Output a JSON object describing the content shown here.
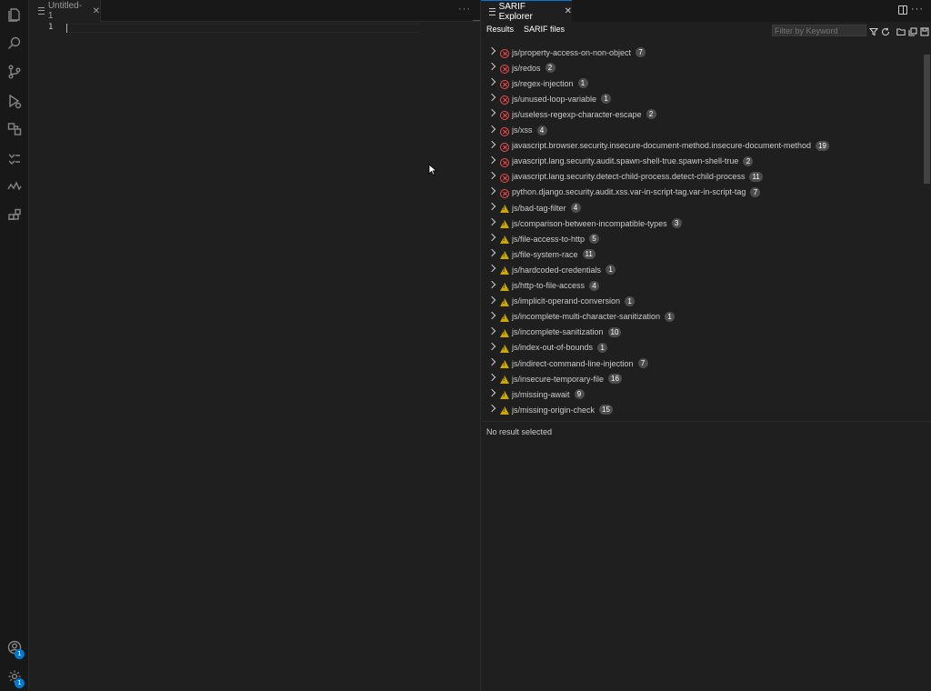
{
  "activity_bar": {
    "accounts_badge": "1",
    "settings_badge": "1"
  },
  "editor": {
    "tab_label": "Untitled-1",
    "line_number": "1"
  },
  "sarif": {
    "tab_label": "SARIF Explorer",
    "results_tab": "Results",
    "files_tab": "SARIF files",
    "filter_placeholder": "Filter by Keyword",
    "no_result_text": "No result selected",
    "rows": [
      {
        "severity": "error",
        "rule": "js/property-access-on-non-object",
        "count": "7"
      },
      {
        "severity": "error",
        "rule": "js/redos",
        "count": "2"
      },
      {
        "severity": "error",
        "rule": "js/regex-injection",
        "count": "1"
      },
      {
        "severity": "error",
        "rule": "js/unused-loop-variable",
        "count": "1"
      },
      {
        "severity": "error",
        "rule": "js/useless-regexp-character-escape",
        "count": "2"
      },
      {
        "severity": "error",
        "rule": "js/xss",
        "count": "4"
      },
      {
        "severity": "error",
        "rule": "javascript.browser.security.insecure-document-method.insecure-document-method",
        "count": "19"
      },
      {
        "severity": "error",
        "rule": "javascript.lang.security.audit.spawn-shell-true.spawn-shell-true",
        "count": "2"
      },
      {
        "severity": "error",
        "rule": "javascript.lang.security.detect-child-process.detect-child-process",
        "count": "11"
      },
      {
        "severity": "error",
        "rule": "python.django.security.audit.xss.var-in-script-tag.var-in-script-tag",
        "count": "7"
      },
      {
        "severity": "warning",
        "rule": "js/bad-tag-filter",
        "count": "4"
      },
      {
        "severity": "warning",
        "rule": "js/comparison-between-incompatible-types",
        "count": "3"
      },
      {
        "severity": "warning",
        "rule": "js/file-access-to-http",
        "count": "5"
      },
      {
        "severity": "warning",
        "rule": "js/file-system-race",
        "count": "11"
      },
      {
        "severity": "warning",
        "rule": "js/hardcoded-credentials",
        "count": "1"
      },
      {
        "severity": "warning",
        "rule": "js/http-to-file-access",
        "count": "4"
      },
      {
        "severity": "warning",
        "rule": "js/implicit-operand-conversion",
        "count": "1"
      },
      {
        "severity": "warning",
        "rule": "js/incomplete-multi-character-sanitization",
        "count": "1"
      },
      {
        "severity": "warning",
        "rule": "js/incomplete-sanitization",
        "count": "10"
      },
      {
        "severity": "warning",
        "rule": "js/index-out-of-bounds",
        "count": "1"
      },
      {
        "severity": "warning",
        "rule": "js/indirect-command-line-injection",
        "count": "7"
      },
      {
        "severity": "warning",
        "rule": "js/insecure-temporary-file",
        "count": "16"
      },
      {
        "severity": "warning",
        "rule": "js/missing-await",
        "count": "9"
      },
      {
        "severity": "warning",
        "rule": "js/missing-origin-check",
        "count": "15"
      }
    ]
  },
  "colors": {
    "error": "#f14c4c",
    "warning": "#cca700",
    "accent": "#0078d4"
  }
}
